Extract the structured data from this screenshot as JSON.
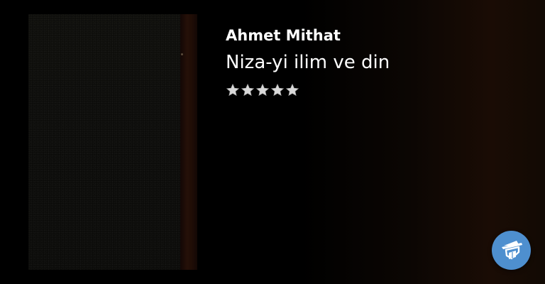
{
  "book": {
    "author": "Ahmet Mithat",
    "title": "Niza-yi ilim ve din",
    "rating": 5,
    "rating_max": 5
  },
  "icons": {
    "cover": "book-cover-image",
    "star": "star-icon",
    "fab": "reader-icon"
  },
  "colors": {
    "background": "#000000",
    "text": "#ffffff",
    "star": "#d9d9d9",
    "fab": "#4e8fcf"
  }
}
